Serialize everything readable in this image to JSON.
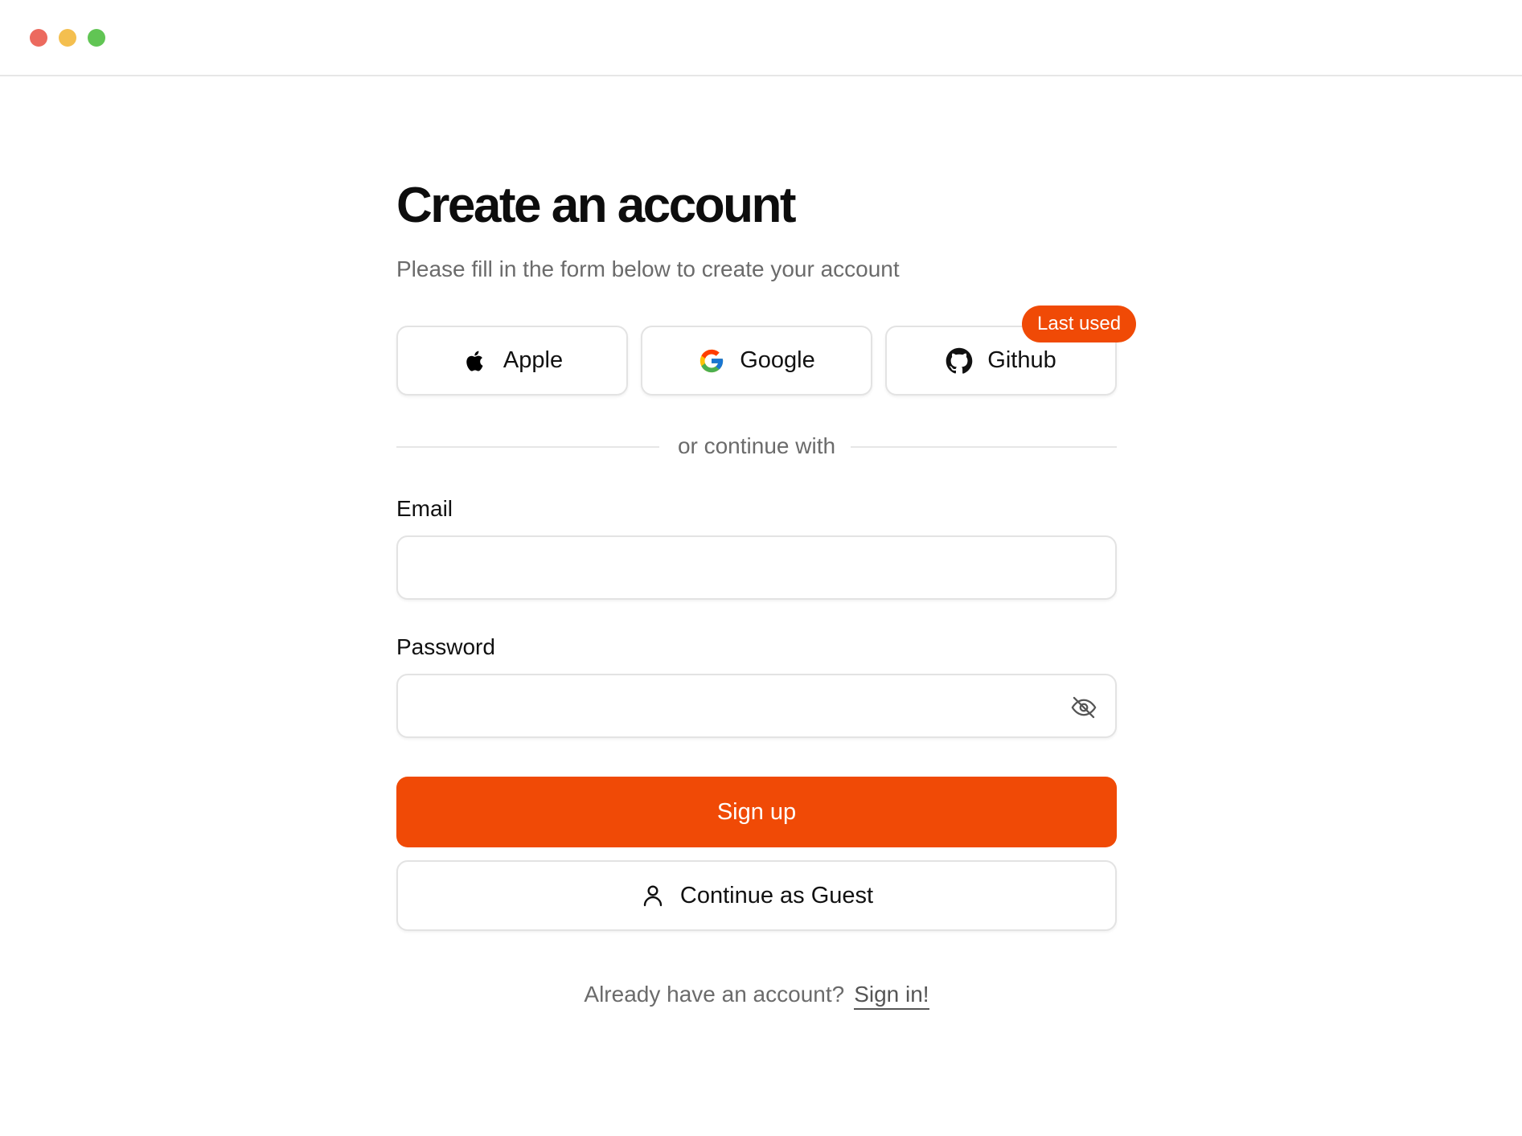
{
  "window": {
    "controls": [
      {
        "name": "close",
        "color": "#ec6a5e"
      },
      {
        "name": "minimize",
        "color": "#f4bf4f"
      },
      {
        "name": "maximize",
        "color": "#61c554"
      }
    ]
  },
  "colors": {
    "accent": "#f04a06",
    "muted_text": "#6b6b6b",
    "border": "#e3e3e3"
  },
  "form": {
    "title": "Create an account",
    "subtitle": "Please fill in the form below to create your account",
    "social": {
      "apple": {
        "label": "Apple",
        "icon": "apple-icon"
      },
      "google": {
        "label": "Google",
        "icon": "google-icon"
      },
      "github": {
        "label": "Github",
        "icon": "github-icon",
        "badge": "Last used"
      }
    },
    "divider_text": "or continue with",
    "email": {
      "label": "Email",
      "value": "",
      "placeholder": ""
    },
    "password": {
      "label": "Password",
      "value": "",
      "placeholder": "",
      "toggle_icon": "eye-off-icon"
    },
    "signup_label": "Sign up",
    "guest": {
      "label": "Continue as Guest",
      "icon": "user-icon"
    },
    "footer": {
      "text": "Already have an account?",
      "link": "Sign in!"
    }
  }
}
